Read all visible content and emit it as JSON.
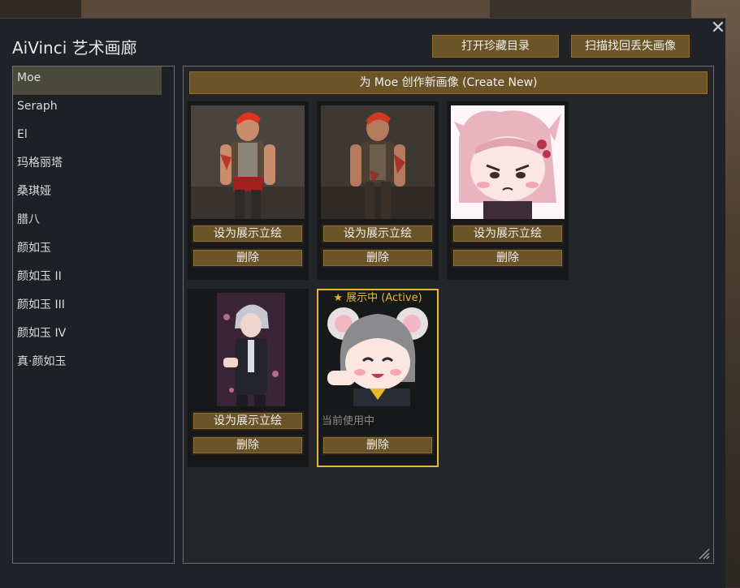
{
  "window": {
    "title": "AiVinci 艺术画廊",
    "close_symbol": "✕"
  },
  "toolbar": {
    "open_archive_label": "打开珍藏目录",
    "scan_lost_label": "扫描找回丢失画像"
  },
  "sidebar": {
    "items": [
      {
        "label": "Moe",
        "selected": true
      },
      {
        "label": "Seraph"
      },
      {
        "label": "El"
      },
      {
        "label": "玛格丽塔"
      },
      {
        "label": "桑琪娅"
      },
      {
        "label": "腊八"
      },
      {
        "label": "颜如玉"
      },
      {
        "label": "颜如玉 II"
      },
      {
        "label": "颜如玉 III"
      },
      {
        "label": "颜如玉 IV"
      },
      {
        "label": "真·颜如玉"
      }
    ]
  },
  "main": {
    "create_label": "为 Moe 创作新画像 (Create New)",
    "set_display_label": "设为展示立绘",
    "delete_label": "删除",
    "active_label": "★ 展示中 (Active)",
    "in_use_label": "当前使用中"
  },
  "colors": {
    "accent_gold": "#e8b92a",
    "button_brown": "#6b5428"
  },
  "cards": [
    {
      "portrait": "red-haired-man-1-image"
    },
    {
      "portrait": "red-haired-man-2-image"
    },
    {
      "portrait": "chibi-pink-catgirl-image"
    },
    {
      "portrait": "silver-haired-man-image"
    },
    {
      "portrait": "chibi-grey-mousegirl-image",
      "active": true
    }
  ]
}
